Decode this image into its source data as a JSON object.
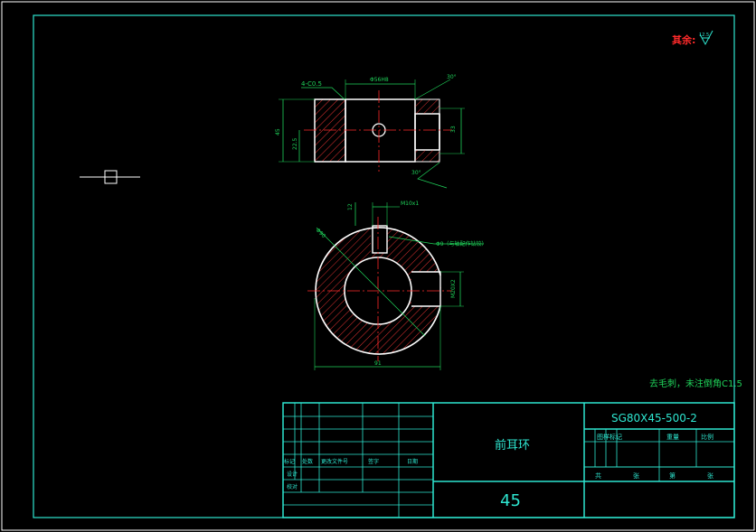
{
  "colors": {
    "background": "#000000",
    "border": "#ffffff",
    "frame": "#2ee6d0",
    "part_outline": "#ffffff",
    "dimension": "#1fd35a",
    "centerline": "#ff2a2a",
    "hatch": "#d93030",
    "note_red": "#ff2a2a"
  },
  "roughness_note": {
    "label": "其余:",
    "value": "12.5"
  },
  "tech_notes": {
    "text": "去毛刺，未注倒角C1.5"
  },
  "front_view": {
    "chamfer_label": "4-C0.5",
    "top_width": "Φ56H8",
    "angle_top": "30°",
    "angle_bottom": "30°",
    "left_dim": "45",
    "inner_dim": "22.5",
    "right_dim": "33"
  },
  "side_view": {
    "slot_width": "M10x1",
    "slot_depth": "12",
    "hole_note": "Φ9（与轴配作钻铰）",
    "outer_dia": "Φ90",
    "thread_right": "M20X2",
    "bottom_dim": "91"
  },
  "title_block": {
    "part_name": "前耳环",
    "material": "45",
    "drawing_no": "SG80X45-500-2",
    "stage_mark": "图样标记",
    "weight": "重量",
    "scale": "比例",
    "sheet_total": "共",
    "sheet_word": "张",
    "sheet_num": "第",
    "sheet_word2": "张",
    "rev_mark": "标记",
    "rev_count": "处数",
    "rev_doc": "更改文件号",
    "rev_sign": "签字",
    "rev_date": "日期",
    "design": "设计",
    "check": "校对"
  }
}
